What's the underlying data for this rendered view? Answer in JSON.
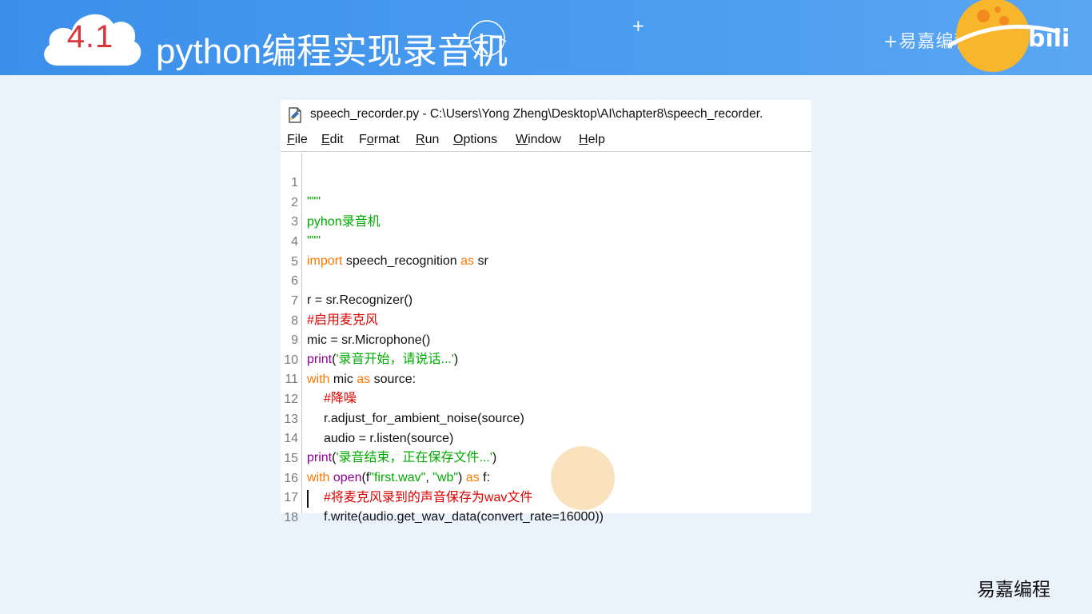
{
  "header": {
    "section_number": "4.1",
    "title": "python编程实现录音机",
    "brand": "易嘉编程",
    "bg_color": "#4a9cf0",
    "accent_color": "#d9363e"
  },
  "window": {
    "title": "speech_recorder.py - C:\\Users\\Yong Zheng\\Desktop\\AI\\chapter8\\speech_recorder.",
    "file_icon": "python-file-icon",
    "menu": [
      {
        "pre": "",
        "u": "F",
        "post": "ile"
      },
      {
        "pre": "",
        "u": "E",
        "post": "dit"
      },
      {
        "pre": "F",
        "u": "o",
        "post": "rmat"
      },
      {
        "pre": "",
        "u": "R",
        "post": "un"
      },
      {
        "pre": "",
        "u": "O",
        "post": "ptions"
      },
      {
        "pre": "",
        "u": "W",
        "post": "indow"
      },
      {
        "pre": "",
        "u": "H",
        "post": "elp"
      }
    ]
  },
  "code": {
    "line_numbers": [
      "1",
      "2",
      "3",
      "4",
      "5",
      "6",
      "7",
      "8",
      "9",
      "10",
      "11",
      "12",
      "13",
      "14",
      "15",
      "16",
      "17",
      "18"
    ],
    "l1": "\"\"\"",
    "l2": "pyhon录音机",
    "l3": "\"\"\"",
    "l4": {
      "kw1": "import",
      "mid": " speech_recognition ",
      "kw2": "as",
      "end": " sr"
    },
    "l6": "r = sr.Recognizer()",
    "l7": "#启用麦克风",
    "l8": "mic = sr.Microphone()",
    "l9": {
      "fn": "print",
      "p1": "(",
      "str": "'录音开始，请说话...'",
      "p2": ")"
    },
    "l10": {
      "kw1": "with",
      "mid": " mic ",
      "kw2": "as",
      "end": " source:"
    },
    "l11": "#降噪",
    "l12": "r.adjust_for_ambient_noise(source)",
    "l13": "audio = r.listen(source)",
    "l14": {
      "fn": "print",
      "p1": "(",
      "str": "'录音结束，正在保存文件...'",
      "p2": ")"
    },
    "l15": {
      "kw1": "with",
      "sp": " ",
      "fn": "open",
      "p1": "(f",
      "s1": "\"first.wav\"",
      "c": ", ",
      "s2": "\"wb\"",
      "p2": ") ",
      "kw2": "as",
      "end": " f:"
    },
    "l16": "#将麦克风录到的声音保存为wav文件",
    "l17": "f.write(audio.get_wav_data(convert_rate=16000))"
  },
  "footer": {
    "brand": "易嘉编程"
  }
}
